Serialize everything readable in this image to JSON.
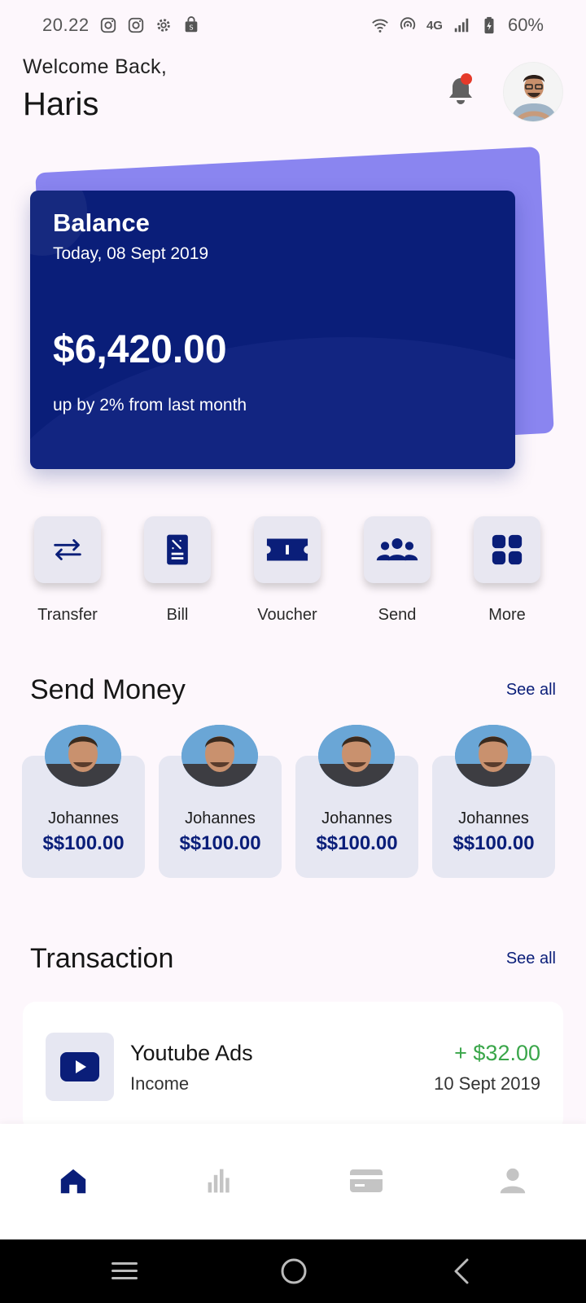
{
  "status_bar": {
    "time": "20.22",
    "left_icons": [
      "instagram-icon",
      "instagram-icon",
      "settings-gear-icon",
      "shopping-bag-icon"
    ],
    "right_icons": [
      "wifi-icon",
      "hotspot-icon",
      "signal-icon",
      "battery-charging-icon"
    ],
    "network": "4G",
    "battery": "60%"
  },
  "header": {
    "welcome": "Welcome Back,",
    "name": "Haris",
    "notification_dot_color": "#e53a2a"
  },
  "balance_card": {
    "title": "Balance",
    "date": "Today, 08 Sept 2019",
    "amount": "$6,420.00",
    "trend": "up by 2% from last month",
    "card_color": "#0a1e79",
    "back_card_color": "#8a85f0"
  },
  "actions": [
    {
      "label": "Transfer",
      "icon": "transfer-arrows-icon"
    },
    {
      "label": "Bill",
      "icon": "bill-receipt-icon"
    },
    {
      "label": "Voucher",
      "icon": "voucher-ticket-icon"
    },
    {
      "label": "Send",
      "icon": "group-people-icon"
    },
    {
      "label": "More",
      "icon": "grid-more-icon"
    }
  ],
  "send_money": {
    "title": "Send Money",
    "see_all": "See all",
    "contacts": [
      {
        "name": "Johannes",
        "amount": "$$100.00"
      },
      {
        "name": "Johannes",
        "amount": "$$100.00"
      },
      {
        "name": "Johannes",
        "amount": "$$100.00"
      },
      {
        "name": "Johannes",
        "amount": "$$100.00"
      }
    ]
  },
  "transaction": {
    "title": "Transaction",
    "see_all": "See all",
    "items": [
      {
        "title": "Youtube Ads",
        "category": "Income",
        "amount": "+ $32.00",
        "date": "10 Sept 2019",
        "icon": "youtube-play-icon",
        "amount_color": "#3aa64a"
      }
    ]
  },
  "bottom_nav": {
    "items": [
      "home-icon",
      "stats-chart-icon",
      "card-icon",
      "profile-icon"
    ],
    "active": "home-icon",
    "active_color": "#0a1e79",
    "inactive_color": "#c4c4c4"
  },
  "system_nav": [
    "recents-icon",
    "home-circle-icon",
    "back-icon"
  ],
  "colors": {
    "background": "#fdf7fc",
    "primary": "#0a1e79",
    "accent_purple": "#8a85f0",
    "income_green": "#3aa64a"
  }
}
